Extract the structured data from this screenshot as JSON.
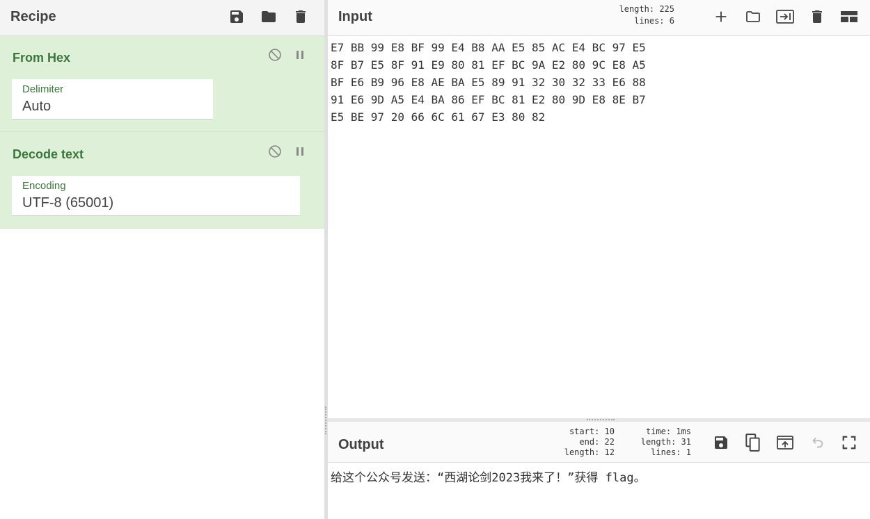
{
  "recipe": {
    "title": "Recipe",
    "icons": [
      "save-icon",
      "folder-icon",
      "trash-icon"
    ],
    "operations": [
      {
        "title": "From Hex",
        "arg_label": "Delimiter",
        "arg_value": "Auto"
      },
      {
        "title": "Decode text",
        "arg_label": "Encoding",
        "arg_value": "UTF-8 (65001)"
      }
    ]
  },
  "input": {
    "title": "Input",
    "stats": {
      "length_label": "length:",
      "length": "225",
      "lines_label": "lines:",
      "lines": "6"
    },
    "lines": [
      "E7 BB 99 E8 BF 99 E4 B8 AA E5 85 AC E4 BC 97 E5",
      "8F B7 E5 8F 91 E9 80 81 EF BC 9A E2 80 9C E8 A5",
      "BF E6 B9 96 E8 AE BA E5 89 91 32 30 32 33 E6 88",
      "91 E6 9D A5 E4 BA 86 EF BC 81 E2 80 9D E8 8E B7",
      "E5 BE 97 20 66 6C 61 67 E3 80 82"
    ]
  },
  "output": {
    "title": "Output",
    "stats": {
      "start_label": "start:",
      "start": "10",
      "end_label": "end:",
      "end": "22",
      "sel_length_label": "length:",
      "sel_length": "12",
      "time_label": "time:",
      "time": "1ms",
      "length_label": "length:",
      "length": "31",
      "lines_label": "lines:",
      "lines": "1"
    },
    "text": "给这个公众号发送：“西湖论剑2023我来了！”获得 flag。"
  },
  "colors": {
    "accent_green": "#3c763d",
    "op_background": "#dff0d8"
  }
}
